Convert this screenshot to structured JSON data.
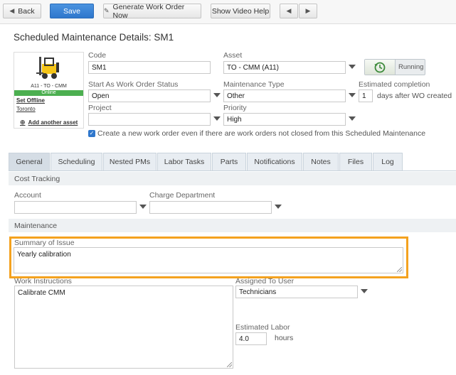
{
  "toolbar": {
    "back_label": "Back",
    "save_label": "Save",
    "generate_label": "Generate Work Order Now",
    "video_label": "Show Video Help"
  },
  "page": {
    "title": "Scheduled Maintenance Details: SM1"
  },
  "asset_card": {
    "asset_caption": "A11 - TO - CMM",
    "status": "Online",
    "set_offline": "Set Offline",
    "location": "Toronto",
    "add_asset": "Add another asset"
  },
  "form": {
    "code_label": "Code",
    "code_value": "SM1",
    "asset_label": "Asset",
    "asset_value": "TO - CMM (A11)",
    "status_label": "Start As Work Order Status",
    "status_value": "Open",
    "type_label": "Maintenance Type",
    "type_value": "Other",
    "est_label": "Estimated completion",
    "est_value": "1",
    "est_suffix": "days after WO created",
    "project_label": "Project",
    "project_value": "",
    "priority_label": "Priority",
    "priority_value": "High",
    "running_label": "Running",
    "create_wo_label": "Create a new work order even if there are work orders not closed from this Scheduled Maintenance"
  },
  "tabs": [
    "General",
    "Scheduling",
    "Nested PMs",
    "Labor Tasks",
    "Parts",
    "Notifications",
    "Notes",
    "Files",
    "Log"
  ],
  "cost": {
    "heading": "Cost Tracking",
    "account_label": "Account",
    "account_value": "",
    "charge_label": "Charge Department",
    "charge_value": ""
  },
  "maintenance": {
    "heading": "Maintenance",
    "summary_label": "Summary of Issue",
    "summary_value": "Yearly calibration",
    "instructions_label": "Work Instructions",
    "instructions_value": "Calibrate CMM",
    "assigned_label": "Assigned To User",
    "assigned_value": "Technicians",
    "labor_label": "Estimated Labor",
    "labor_value": "4.0",
    "labor_unit": "hours"
  },
  "colors": {
    "accent": "#2f77cc",
    "online": "#4caf50",
    "highlight": "#f4a21f"
  }
}
